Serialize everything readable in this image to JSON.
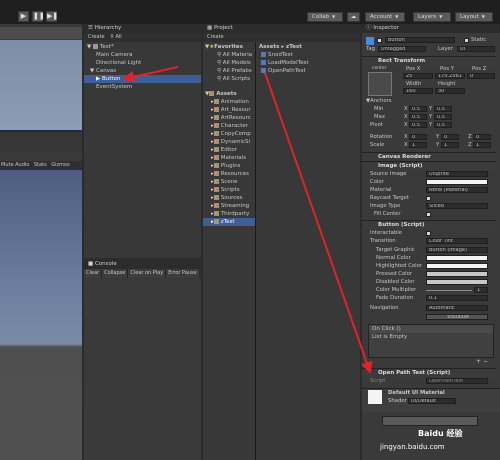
{
  "toolbar": {
    "collab": "Collab",
    "account": "Account",
    "layers": "Layers",
    "layout": "Layout"
  },
  "game": {
    "options": [
      "Mute Audio",
      "Stats",
      "Gizmos"
    ]
  },
  "hierarchy": {
    "title": "Hierarchy",
    "create": "Create",
    "search": "All",
    "scene": "Test*",
    "items": [
      "Main Camera",
      "Directional Light",
      "Canvas",
      "Button",
      "EventSystem"
    ]
  },
  "project": {
    "title": "Project",
    "create": "Create",
    "favorites": "Favorites",
    "fav_items": [
      "All Materia",
      "All Models",
      "All Prefabs",
      "All Scripts"
    ],
    "assets": "Assets",
    "asset_folders": [
      "Animation",
      "Art_Resour",
      "ArtResourc",
      "Character",
      "CopyComp",
      "DynamicSi",
      "Editor",
      "Materials",
      "Plugins",
      "Resources",
      "Scene",
      "Scripts",
      "Sources",
      "Streaming",
      "Thirdparty",
      "zTest"
    ],
    "breadcrumb": [
      "Assets",
      "zTest"
    ],
    "files": [
      "SnodTest",
      "LoadModelTest",
      "OpenPathTest"
    ]
  },
  "console": {
    "title": "Console",
    "buttons": [
      "Clear",
      "Collapse",
      "Clear on Play",
      "Error Pause"
    ]
  },
  "inspector": {
    "title": "Inspector",
    "object_name": "Button",
    "static": "Static",
    "tag_label": "Tag",
    "tag_value": "Untagged",
    "layer_label": "Layer",
    "layer_value": "UI",
    "rect": {
      "title": "Rect Transform",
      "anchor": "center",
      "pos_labels": [
        "Pos X",
        "Pos Y",
        "Pos Z"
      ],
      "pos_values": [
        "25",
        "170.2561",
        "0"
      ],
      "size_labels": [
        "Width",
        "Height"
      ],
      "size_values": [
        "160",
        "30"
      ],
      "anchors": "Anchors",
      "min_label": "Min",
      "max_label": "Max",
      "pivot_label": "Pivot",
      "min": [
        "0.5",
        "0.5"
      ],
      "max": [
        "0.5",
        "0.5"
      ],
      "pivot": [
        "0.5",
        "0.5"
      ],
      "rotation_label": "Rotation",
      "rotation": [
        "0",
        "0",
        "0"
      ],
      "scale_label": "Scale",
      "scale": [
        "1",
        "1",
        "1"
      ]
    },
    "canvas_renderer": "Canvas Renderer",
    "image": {
      "title": "Image (Script)",
      "source_label": "Source Image",
      "source": "UISprite",
      "color_label": "Color",
      "material_label": "Material",
      "material": "None (Material)",
      "raycast_label": "Raycast Target",
      "type_label": "Image Type",
      "type": "Sliced",
      "fill_label": "Fill Center"
    },
    "button": {
      "title": "Button (Script)",
      "interactable_label": "Interactable",
      "transition_label": "Transition",
      "transition": "Color Tint",
      "target_label": "Target Graphic",
      "target": "Button (Image)",
      "normal": "Normal Color",
      "highlighted": "Highlighted Color",
      "pressed": "Pressed Color",
      "disabled": "Disabled Color",
      "multiplier_label": "Color Multiplier",
      "multiplier": "1",
      "fade_label": "Fade Duration",
      "fade": "0.1",
      "navigation_label": "Navigation",
      "navigation": "Automatic",
      "visualize": "Visualize",
      "onclick": "On Click ()",
      "list_empty": "List is Empty"
    },
    "openpath": {
      "title": "Open Path Test (Script)",
      "script_label": "Script",
      "script": "OpenPathTest"
    },
    "material": {
      "name": "Default UI Material",
      "shader_label": "Shader",
      "shader": "UI/Default"
    },
    "colors": {
      "normal": "#f2f2f2",
      "highlighted": "#f5f5f5",
      "pressed": "#c8c8c8",
      "disabled": "#c8c8c8"
    }
  },
  "watermark": "jingyan.baidu.com",
  "watermark_logo": "Baidu 经验"
}
